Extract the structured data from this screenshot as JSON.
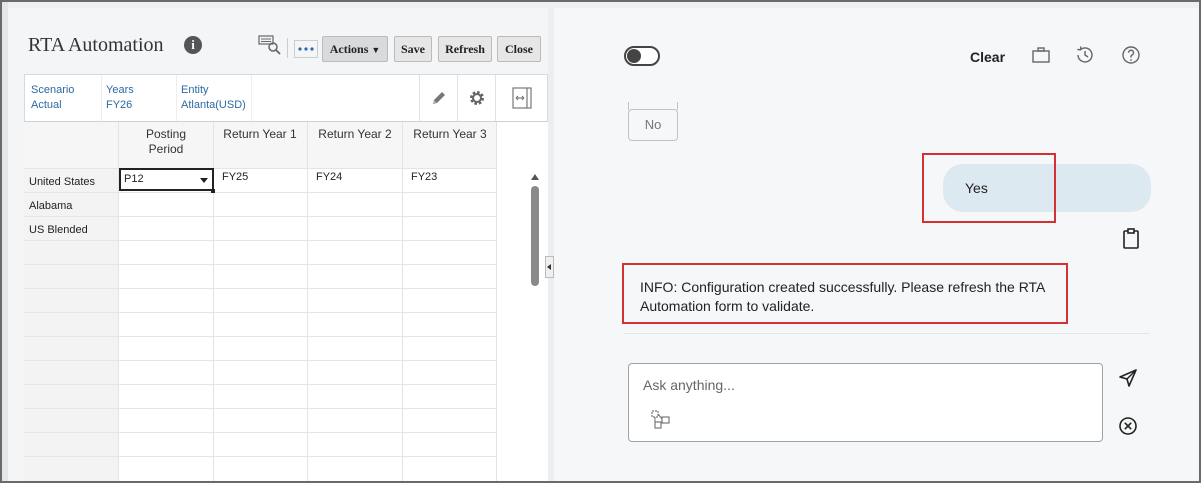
{
  "form": {
    "title": "RTA Automation",
    "buttons": {
      "actions": "Actions",
      "save": "Save",
      "refresh": "Refresh",
      "close": "Close"
    },
    "pov": [
      {
        "label": "Scenario",
        "value": "Actual"
      },
      {
        "label": "Years",
        "value": "FY26"
      },
      {
        "label": "Entity",
        "value": "Atlanta(USD)"
      }
    ],
    "grid": {
      "columns": [
        "Posting Period",
        "Return Year 1",
        "Return Year 2",
        "Return Year 3"
      ],
      "rows": [
        {
          "label": "United States",
          "cells": [
            "P12",
            "FY25",
            "FY24",
            "FY23"
          ]
        },
        {
          "label": "Alabama",
          "cells": [
            "",
            "",
            "",
            ""
          ]
        },
        {
          "label": "US Blended",
          "cells": [
            "",
            "",
            "",
            ""
          ]
        }
      ]
    }
  },
  "assistant": {
    "clear_label": "Clear",
    "no_label": "No",
    "user_message": "Yes",
    "info_message": "INFO: Configuration created successfully. Please refresh the RTA Automation form to validate.",
    "input_placeholder": "Ask anything...",
    "input_value": ""
  },
  "colors": {
    "highlight": "#d43232",
    "link": "#2c6aa0",
    "user_bubble": "#dde9f0"
  },
  "icons": {
    "toolbar": [
      "search-data-icon",
      "more-options-icon"
    ],
    "pov_tools": [
      "pencil-icon",
      "gear-icon",
      "expand-icon"
    ],
    "assistant_header": [
      "briefcase-icon",
      "history-icon",
      "help-icon"
    ],
    "assistant_misc": [
      "clipboard-icon",
      "attach-icon",
      "send-icon",
      "cancel-icon"
    ]
  }
}
